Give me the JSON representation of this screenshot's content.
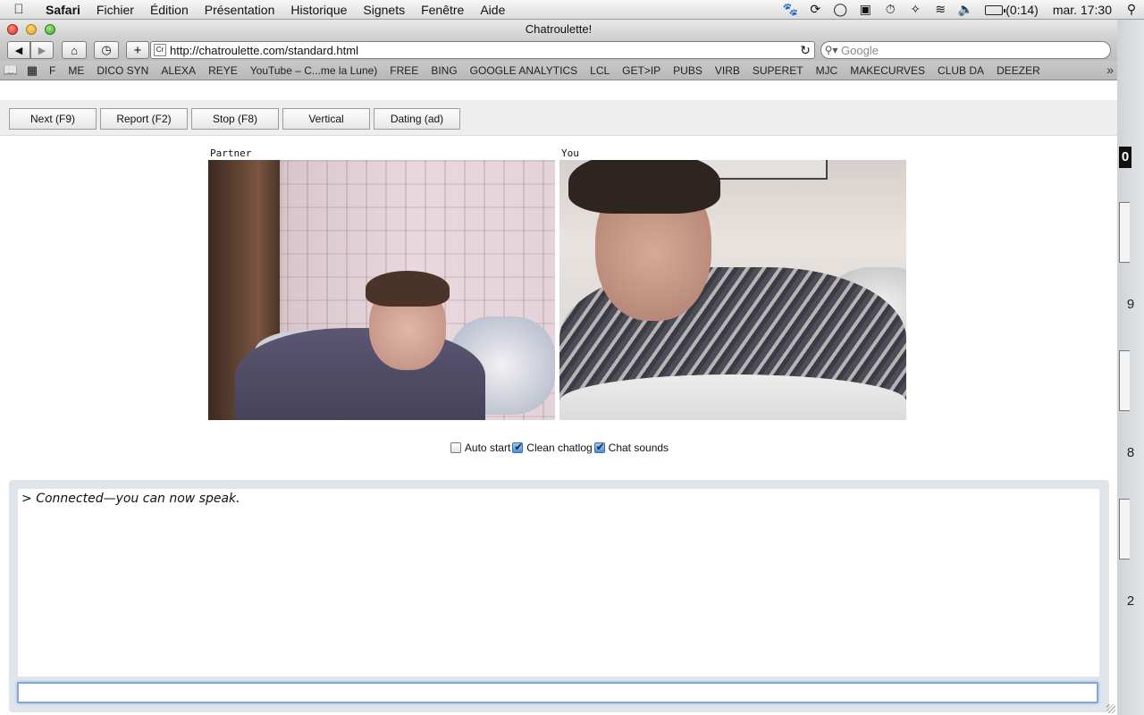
{
  "menubar": {
    "app_name": "Safari",
    "menus": [
      "Fichier",
      "Édition",
      "Présentation",
      "Historique",
      "Signets",
      "Fenêtre",
      "Aide"
    ],
    "battery_text": "(0:14)",
    "clock": "mar. 17:30"
  },
  "window": {
    "title": "Chatroulette!",
    "url": "http://chatroulette.com/standard.html",
    "favicon_text": "Cr",
    "search_placeholder": "Google",
    "bookmarks": [
      "F",
      "ME",
      "DICO SYN",
      "ALEXA",
      "REYE",
      "YouTube – C...me la Lune)",
      "FREE",
      "BING",
      "GOOGLE ANALYTICS",
      "LCL",
      "GET>IP",
      "PUBS",
      "VIRB",
      "SUPERET",
      "MJC",
      "MAKECURVES",
      "CLUB DA",
      "DEEZER"
    ],
    "more_bookmarks": "»"
  },
  "page": {
    "buttons": {
      "next": "Next (F9)",
      "report": "Report (F2)",
      "stop": "Stop (F8)",
      "vertical": "Vertical",
      "dating": "Dating (ad)"
    },
    "video_labels": {
      "partner": "Partner",
      "you": "You"
    },
    "options": {
      "auto_start": {
        "label": "Auto start",
        "checked": false
      },
      "clean_chatlog": {
        "label": "Clean chatlog",
        "checked": true
      },
      "chat_sounds": {
        "label": "Chat sounds",
        "checked": true
      }
    },
    "chat": {
      "prompt": ">",
      "message": "Connected—you can now speak.",
      "input_value": ""
    }
  },
  "desktop": {
    "badge": "0",
    "numbers": [
      "9",
      "8",
      "2"
    ]
  }
}
